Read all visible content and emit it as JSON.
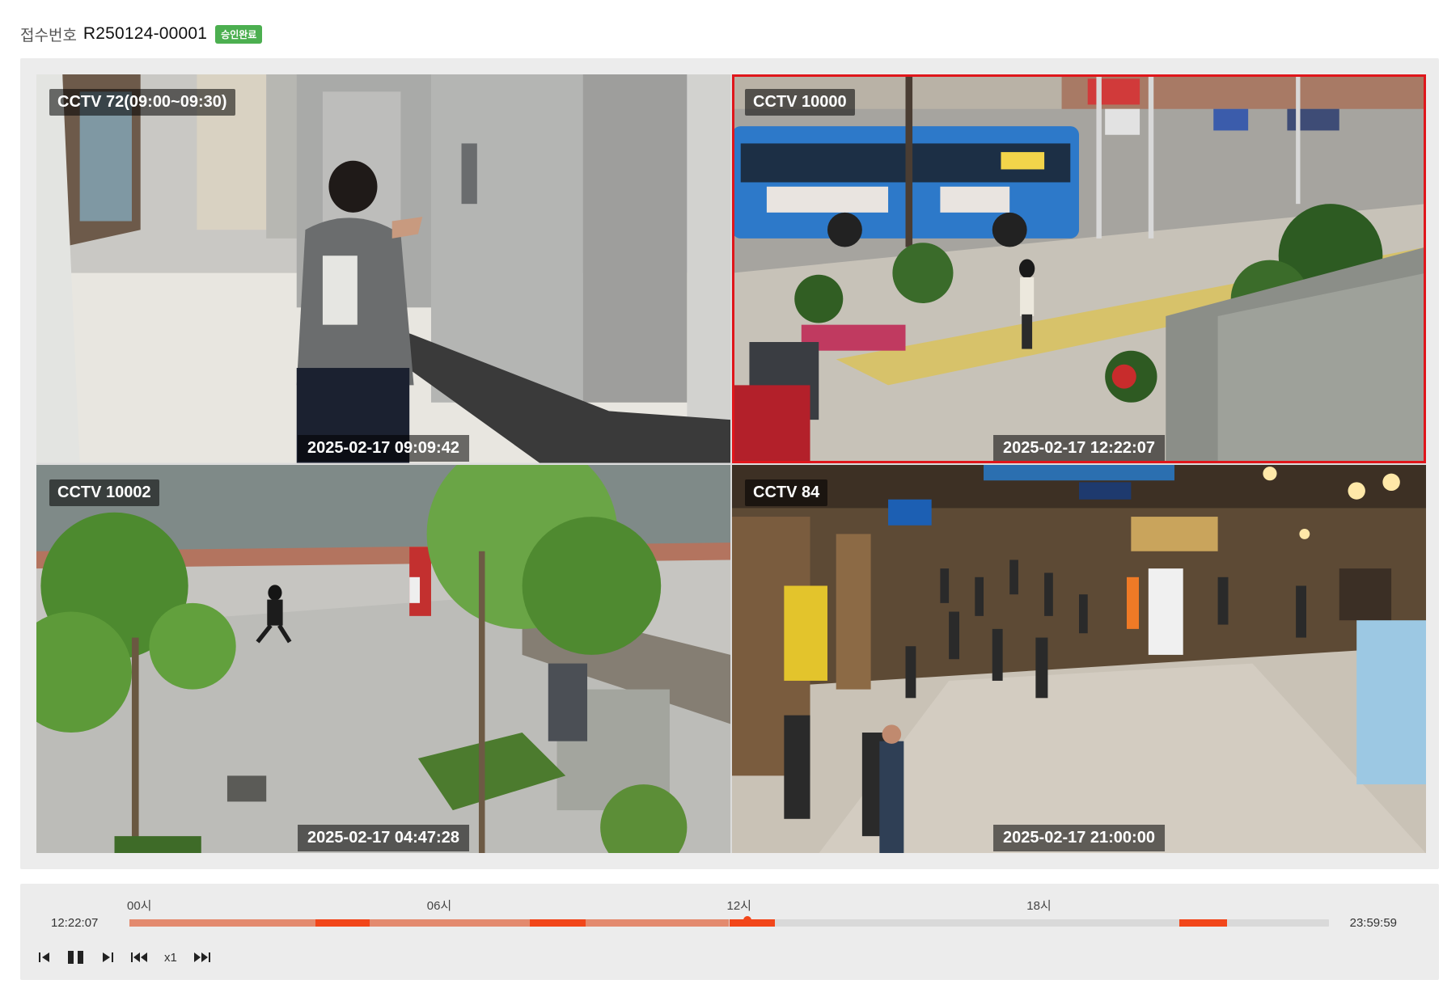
{
  "header": {
    "label": "접수번호",
    "number": "R250124-00001",
    "status": "승인완료",
    "status_color": "#4caf50"
  },
  "accent_color": "#e0161b",
  "cameras": [
    {
      "label": "CCTV 72(09:00~09:30)",
      "timestamp": "2025-02-17 09:09:42",
      "selected": false,
      "scene": "building-lobby-with-elevators"
    },
    {
      "label": "CCTV 10000",
      "timestamp": "2025-02-17 12:22:07",
      "selected": true,
      "scene": "street-with-blue-bus"
    },
    {
      "label": "CCTV 10002",
      "timestamp": "2025-02-17 04:47:28",
      "selected": false,
      "scene": "paved-plaza-with-trees"
    },
    {
      "label": "CCTV 84",
      "timestamp": "2025-02-17 21:00:00",
      "selected": false,
      "scene": "crowded-station-concourse"
    }
  ],
  "timeline": {
    "start_time": "12:22:07",
    "end_time": "23:59:59",
    "hour_labels": [
      "00시",
      "06시",
      "12시",
      "18시"
    ],
    "playhead_fraction": 0.515,
    "recorded_segments": [
      [
        0.0,
        0.155
      ],
      [
        0.2,
        0.334
      ],
      [
        0.38,
        0.5
      ]
    ],
    "event_segments": [
      [
        0.155,
        0.2
      ],
      [
        0.334,
        0.38
      ],
      [
        0.5,
        0.538
      ],
      [
        0.875,
        0.915
      ]
    ],
    "recorded_color": "#e38a6e",
    "event_color": "#f2461a"
  },
  "controls": {
    "speed": "x1",
    "buttons": [
      "step-back-icon",
      "pause-icon",
      "step-forward-icon",
      "rewind-icon",
      "fast-forward-icon"
    ]
  }
}
